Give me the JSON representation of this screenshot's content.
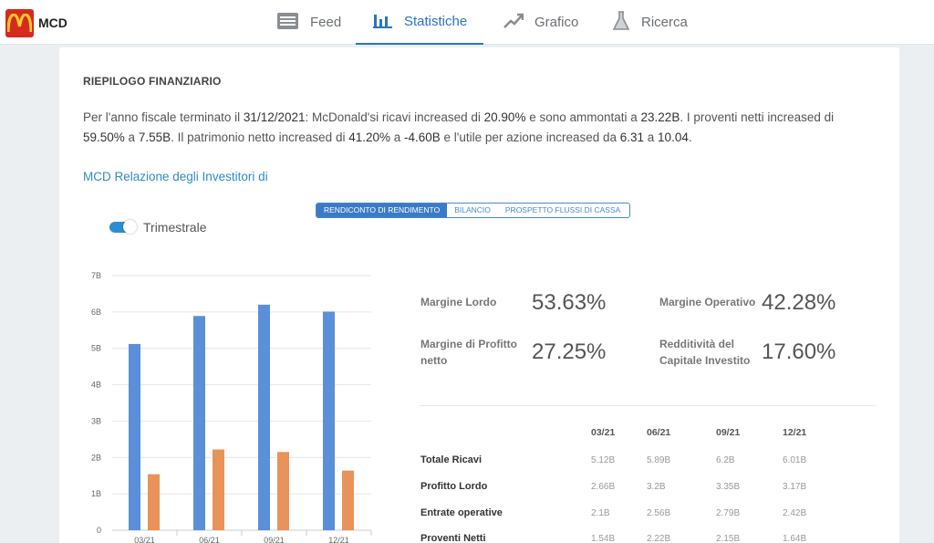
{
  "app": {
    "ticker": "MCD",
    "accent": "#2b74bd",
    "logo_icon": "mcdonalds-arches-logo"
  },
  "nav": {
    "tabs": [
      {
        "label": "Feed",
        "icon": "newspaper-icon",
        "active": false
      },
      {
        "label": "Statistiche",
        "icon": "bar-chart-icon",
        "active": true
      },
      {
        "label": "Grafico",
        "icon": "trend-up-icon",
        "active": false
      },
      {
        "label": "Ricerca",
        "icon": "flask-icon",
        "active": false
      }
    ]
  },
  "summary": {
    "title": "RIEPILOGO FINANZIARIO",
    "p1": "Per l'anno fiscale terminato il ",
    "date": "31/12/2021",
    "p2": ": McDonald's",
    "p3": "i ricavi increased di ",
    "rev_growth": "20.90%",
    "p4": " e sono ammontati a ",
    "revenue": "23.22B",
    "p5": ". I proventi netti increased di ",
    "ni_growth": "59.50%",
    "p6": " a ",
    "net_income": "7.55B",
    "p7": ". Il patrimonio netto increased di ",
    "eq_growth": "41.20%",
    "p8": " a ",
    "equity": "-4.60B",
    "p9": " e l'utile per azione increased da ",
    "eps_from": "6.31",
    "p10": " a ",
    "eps_to": "10.04",
    "p11": "."
  },
  "ir_link": "MCD Relazione degli Investitori di",
  "statements": {
    "options": [
      "RENDICONTO DI RENDIMENTO",
      "BILANCIO",
      "PROSPETTO FLUSSI DI CASSA"
    ],
    "selected": 0
  },
  "toggle": {
    "label": "Trimestrale",
    "on": true
  },
  "chart_data": {
    "type": "bar",
    "categories": [
      "03/21",
      "06/21",
      "09/21",
      "12/21"
    ],
    "series": [
      {
        "values": [
          5.12,
          5.89,
          6.2,
          6.01
        ],
        "color": "#5b8fd9"
      },
      {
        "values": [
          1.54,
          2.22,
          2.15,
          1.64
        ],
        "color": "#e8935a"
      }
    ],
    "yticks": [
      "0",
      "1B",
      "2B",
      "3B",
      "4B",
      "5B",
      "6B",
      "7B"
    ],
    "ylim": [
      0,
      7
    ],
    "grid": true
  },
  "ratios": [
    {
      "label": "Margine Lordo",
      "value": "53.63%"
    },
    {
      "label": "Margine Operativo",
      "value": "42.28%"
    },
    {
      "label_line1": "Margine di Profitto",
      "label_line2": "netto",
      "value": "27.25%"
    },
    {
      "label_line1": "Redditività del",
      "label_line2": "Capitale Investito",
      "value": "17.60%"
    }
  ],
  "table": {
    "columns": [
      "03/21",
      "06/21",
      "09/21",
      "12/21"
    ],
    "rows": [
      {
        "label": "Totale Ricavi",
        "values": [
          "5.12B",
          "5.89B",
          "6.2B",
          "6.01B"
        ]
      },
      {
        "label": "Profitto Lordo",
        "values": [
          "2.66B",
          "3.2B",
          "3.35B",
          "3.17B"
        ]
      },
      {
        "label": "Entrate operative",
        "values": [
          "2.1B",
          "2.56B",
          "2.79B",
          "2.42B"
        ]
      },
      {
        "label": "Proventi Netti",
        "values": [
          "1.54B",
          "2.22B",
          "2.15B",
          "1.64B"
        ]
      }
    ]
  }
}
